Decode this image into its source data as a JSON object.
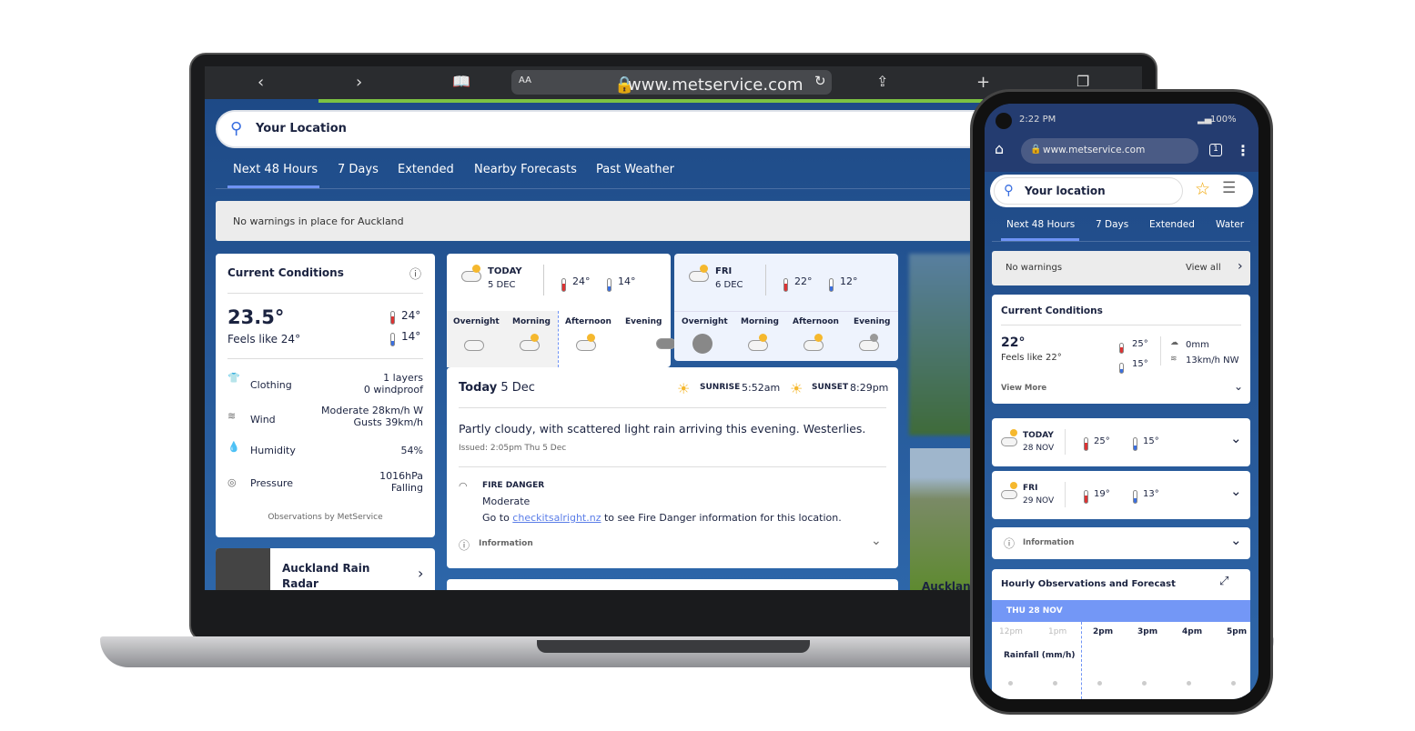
{
  "browser": {
    "text_size": "AA",
    "url": "www.metservice.com"
  },
  "search": {
    "placeholder": "Your Location"
  },
  "tabs": [
    "Next 48 Hours",
    "7 Days",
    "Extended",
    "Nearby Forecasts",
    "Past Weather"
  ],
  "warning": "No warnings in place for Auckland",
  "current": {
    "title": "Current Conditions",
    "temp": "23.5°",
    "feels": "Feels like 24°",
    "high": "24°",
    "low": "14°",
    "rows": [
      {
        "icon": "shirt-icon",
        "label": "Clothing",
        "value": [
          "1 layers",
          "0 windproof"
        ]
      },
      {
        "icon": "wind-icon",
        "label": "Wind",
        "value": [
          "Moderate 28km/h W",
          "Gusts 39km/h"
        ]
      },
      {
        "icon": "humidity-icon",
        "label": "Humidity",
        "value": [
          "54%"
        ]
      },
      {
        "icon": "pressure-icon",
        "label": "Pressure",
        "value": [
          "1016hPa",
          "Falling"
        ]
      }
    ],
    "source": "Observations by MetService"
  },
  "radar": {
    "title": "Auckland Rain Radar"
  },
  "days": [
    {
      "day": "TODAY",
      "date": "5 DEC",
      "high": "24°",
      "low": "14°",
      "periods": [
        "Overnight",
        "Morning",
        "Afternoon",
        "Evening"
      ]
    },
    {
      "day": "FRI",
      "date": "6 DEC",
      "high": "22°",
      "low": "12°",
      "periods": [
        "Overnight",
        "Morning",
        "Afternoon",
        "Evening"
      ]
    }
  ],
  "detail": {
    "title": "Today",
    "date": "5 Dec",
    "sunrise_label": "SUNRISE",
    "sunrise": "5:52am",
    "sunset_label": "SUNSET",
    "sunset": "8:29pm",
    "summary": "Partly cloudy, with scattered light rain arriving this evening. Westerlies.",
    "issued": "Issued: 2:05pm Thu 5 Dec",
    "fire_label": "FIRE DANGER",
    "fire_level": "Moderate",
    "fire_pre": "Go to ",
    "fire_link": "checkitsalright.nz",
    "fire_post": " to see Fire Danger information for this location.",
    "info": "Information"
  },
  "side": {
    "cam_title": "Aucklan"
  },
  "phone": {
    "time": "2:22 PM",
    "battery": "100%",
    "url": "www.metservice.com",
    "tabs_count": "1",
    "search": "Your location",
    "tabs": [
      "Next 48 Hours",
      "7 Days",
      "Extended",
      "Water"
    ],
    "warning": "No warnings",
    "view_all": "View all",
    "current": {
      "title": "Current Conditions",
      "temp": "22°",
      "feels": "Feels like 22°",
      "high": "25°",
      "low": "15°",
      "rain": "0mm",
      "wind": "13km/h NW",
      "more": "View More"
    },
    "days": [
      {
        "day": "TODAY",
        "date": "28 NOV",
        "high": "25°",
        "low": "15°"
      },
      {
        "day": "FRI",
        "date": "29 NOV",
        "high": "19°",
        "low": "13°"
      }
    ],
    "info": "Information",
    "hourly_title": "Hourly Observations and Forecast",
    "hourly_date": "THU 28 NOV",
    "hours": [
      "12pm",
      "1pm",
      "2pm",
      "3pm",
      "4pm",
      "5pm"
    ],
    "rainfall": "Rainfall (mm/h)"
  },
  "colors": {
    "brand_blue": "#1f4a85",
    "accent": "#6f93f5",
    "highlight_date": "#7397f6"
  }
}
